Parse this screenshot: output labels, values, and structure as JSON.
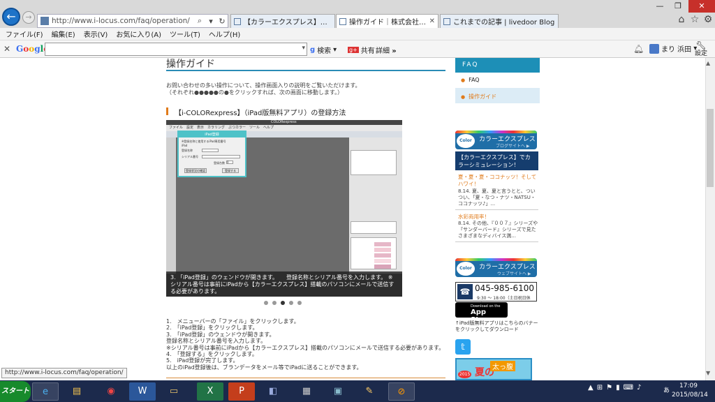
{
  "browser": {
    "url": "http://www.i-locus.com/faq/operation/",
    "tabs": [
      {
        "label": "【カラーエクスプレス】でカラーシミュ..."
      },
      {
        "label": "操作ガイド｜株式会社インタ..."
      },
      {
        "label": "これまでの記事 | livedoor Blog"
      }
    ],
    "menu": [
      "ファイル(F)",
      "編集(E)",
      "表示(V)",
      "お気に入り(A)",
      "ツール(T)",
      "ヘルプ(H)"
    ]
  },
  "google_bar": {
    "logo": "Google",
    "search_label": "検索",
    "share_label": "共有",
    "detail_label": "詳細",
    "user_name": "まり 浜田",
    "settings_label": "設定"
  },
  "page": {
    "heading": "操作ガイド",
    "intro_line1": "お問い合わせの多い操作について、操作画面入りの説明をご覧いただけます。",
    "intro_line2": "（それぞれ●●●●●の●をクリックすれば、次の画面に移動します。）",
    "section_title": "【i-COLORexpress】（iPad版無料アプリ）の登録方法",
    "slide": {
      "app_title": "COLORexpress",
      "menu_text": "ファイル　設定　表示　カラリング　ぶつカラー　ツール　ヘルプ",
      "dialog_title": "iPad登録",
      "dialog_line1": "※登録名称と使用するiPad専用番号",
      "dialog_line2": "iPad",
      "dialog_label_name": "登録名称",
      "dialog_label_serial": "シリアル番号",
      "dialog_label_count": "登録台数",
      "dialog_count_value": "0",
      "dialog_btn_confirm": "登録状況の確認",
      "dialog_btn_register": "登録する",
      "caption": "3. 「iPad登録」のウェンドウが開きます。　　登録名称とシリアル番号を入力します。 ※シリアル番号は事前にiPadから【カラーエクスプレス】搭載のパソコンにメールで送信する必要があります。"
    },
    "steps": [
      "1.　メニューバーの「ファイル」をクリックします。",
      "2.　「iPad登録」をクリックします。",
      "3.　「iPad登録」のウェンドウが開きます。",
      "登録名称とシリアル番号を入力します。",
      "※シリアル番号は事前にiPadから【カラーエクスプレス】搭載のパソコンにメールで送信する必要があります。",
      "4.　「登録する」をクリックします。",
      "5.　iPad登録が完了します。",
      "以上のiPad登録後は、ブランデータをメール等でiPadに送ることができます。"
    ]
  },
  "sidebar": {
    "faq_header": "FAQ",
    "faq_items": [
      "FAQ",
      "操作ガイド"
    ],
    "banner1_title": "カラーエクスプレス",
    "banner1_sub": "ブログサイトへ ▶",
    "banner_logo": "Color express",
    "blog_box": "【カラーエクスプレス】でカラーシミュレーション！",
    "blog1_title": "夏・夏・夏・ココナッツ！そしてハワイ！",
    "blog1_text": "8.14. 夏、夏、夏と言うとと、ついつい、「夏・なつ・ナツ・NATSU・ココナッツ♪」...",
    "blog2_title": "水彩両用率！",
    "blog2_text": "8.14. その他、『００７』シリーズや『サンダーバード』シリーズで見たさまざまなディバイス満...",
    "banner2_title": "カラーエクスプレス",
    "banner2_sub": "ウェブサイトへ ▶",
    "phone": "045-985-6100",
    "phone_hours": "9:30 〜 18:00（土日祝日休み）",
    "appstore_small": "Download on the",
    "appstore_big": "App Store",
    "app_note": "↑iPad版無料アプリはこちらのバナーをクリックしてダウンロード",
    "summer_text": "夏の",
    "summer_badge": "太っ腹",
    "summer_year": "2015"
  },
  "status_url": "http://www.i-locus.com/faq/operation/",
  "taskbar": {
    "start_label": "スタート",
    "ime": "あ",
    "time": "17:09",
    "date": "2015/08/14"
  }
}
